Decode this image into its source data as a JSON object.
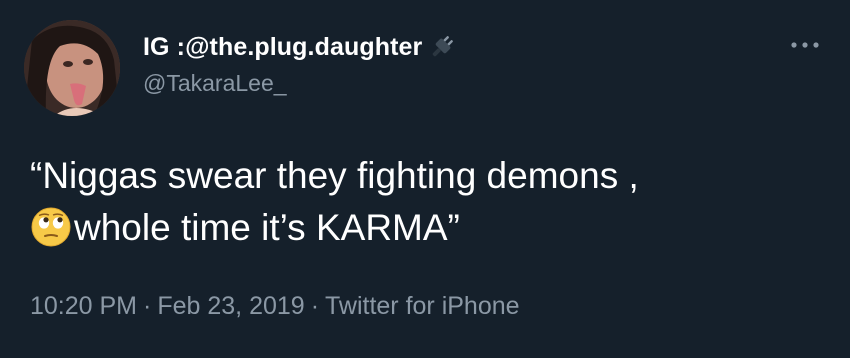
{
  "tweet": {
    "display_name": "IG :@the.plug.daughter",
    "handle": "@TakaraLee_",
    "text_line1": "“Niggas swear they fighting demons ,",
    "text_line2": "whole time it’s KARMA”",
    "emoji_icon": "face-with-rolling-eyes-icon",
    "time": "10:20 PM",
    "date": "Feb 23, 2019",
    "source": "Twitter for iPhone",
    "separator": "·"
  },
  "colors": {
    "background": "#15202b",
    "primary_text": "#ffffff",
    "secondary_text": "#8b98a5"
  }
}
